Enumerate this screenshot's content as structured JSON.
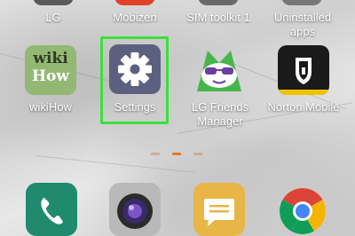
{
  "top_row": [
    {
      "label": "LG",
      "icon": "lg-icon",
      "color": "#5a5a5a"
    },
    {
      "label": "Mobizen",
      "icon": "mobizen-icon",
      "color": "#e0412b"
    },
    {
      "label": "SIM toolkit 1",
      "icon": "sim-toolkit-icon",
      "color": "#6a6a6a"
    },
    {
      "label": "Uninstalled apps",
      "label_line1": "Uninstalled",
      "label_line2": "apps",
      "icon": "uninstalled-apps-icon",
      "color": "#777777"
    }
  ],
  "middle_row": [
    {
      "label": "wikiHow",
      "icon": "wikihow-icon",
      "icon_text_1": "wiki",
      "icon_text_2": "How",
      "color": "#93b874"
    },
    {
      "label": "Settings",
      "icon": "gear-icon",
      "color": "#5c6080"
    },
    {
      "label": "LG Friends Manager",
      "label_line1": "LG Friends",
      "label_line2": "Manager",
      "icon": "lg-friends-icon",
      "color": "#46b64b"
    },
    {
      "label": "Norton Mobile",
      "icon": "norton-shield-icon",
      "color": "#1a1a1a"
    }
  ],
  "highlight_color": "#3be03a",
  "page_indicator": {
    "pages": 3,
    "active_index": 1,
    "active_color": "#e07a2a",
    "inactive_color": "#c9a47a"
  },
  "dock": [
    {
      "icon": "phone-icon",
      "color": "#1f8a6e"
    },
    {
      "icon": "camera-icon",
      "color": "#b9b9b9"
    },
    {
      "icon": "messaging-icon",
      "color": "#e8b646"
    },
    {
      "icon": "chrome-icon",
      "color": "#ffffff"
    }
  ]
}
